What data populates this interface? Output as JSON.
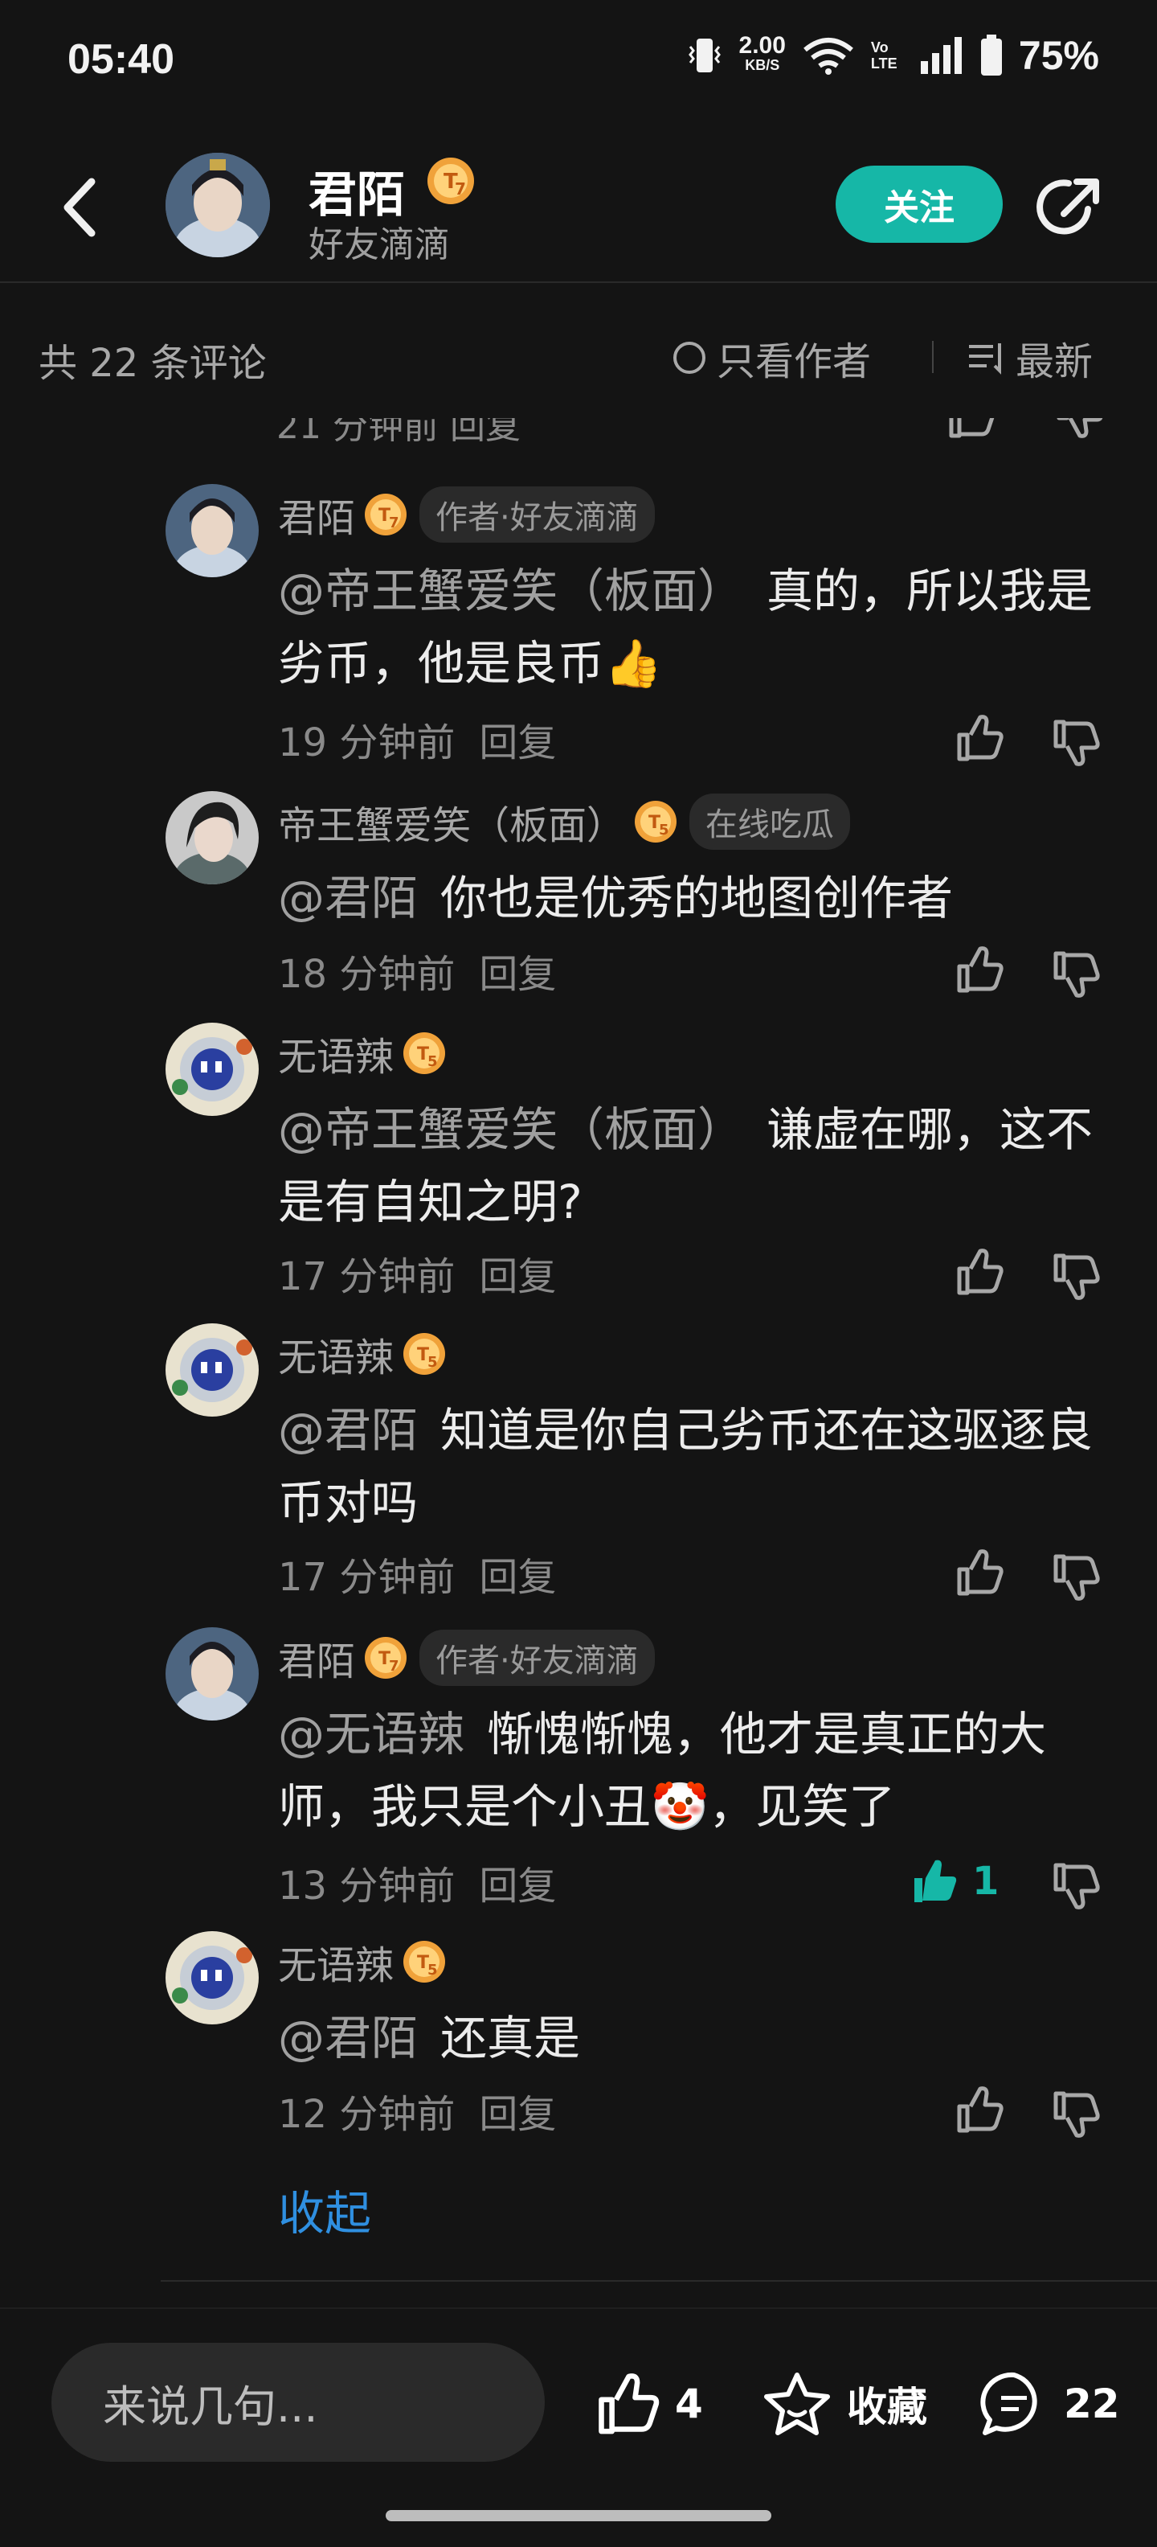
{
  "status_bar": {
    "time": "05:40",
    "net_speed_value": "2.00",
    "net_speed_unit": "KB/S",
    "volte": "Vo LTE",
    "battery": "75%"
  },
  "header": {
    "name": "君陌",
    "level_badge": "7",
    "subtitle": "好友滴滴",
    "follow_label": "关注"
  },
  "comment_bar": {
    "total": "共 22 条评论",
    "only_author": "只看作者",
    "sort": "最新"
  },
  "partial_row": {
    "text": "21 分钟前 回复"
  },
  "comments": [
    {
      "name": "君陌",
      "badge": "7",
      "tag": "作者·好友滴滴",
      "mention": "@帝王蟹爱笑（板面）",
      "text": "真的，所以我是劣币，他是良币👍",
      "time": "19 分钟前",
      "reply": "回复"
    },
    {
      "name": "帝王蟹爱笑（板面）",
      "badge": "5",
      "tag": "在线吃瓜",
      "mention": "@君陌",
      "text": "你也是优秀的地图创作者",
      "time": "18 分钟前",
      "reply": "回复"
    },
    {
      "name": "无语辣",
      "badge": "5",
      "tag": "",
      "mention": "@帝王蟹爱笑（板面）",
      "text": "谦虚在哪，这不是有自知之明?",
      "time": "17 分钟前",
      "reply": "回复"
    },
    {
      "name": "无语辣",
      "badge": "5",
      "tag": "",
      "mention": "@君陌",
      "text": "知道是你自己劣币还在这驱逐良币对吗",
      "time": "17 分钟前",
      "reply": "回复"
    },
    {
      "name": "君陌",
      "badge": "7",
      "tag": "作者·好友滴滴",
      "mention": "@无语辣",
      "text": "惭愧惭愧，他才是真正的大师，我只是个小丑🤡，见笑了",
      "time": "13 分钟前",
      "reply": "回复",
      "likes": "1"
    },
    {
      "name": "无语辣",
      "badge": "5",
      "tag": "",
      "mention": "@君陌",
      "text": "还真是",
      "time": "12 分钟前",
      "reply": "回复"
    }
  ],
  "collapse_label": "收起",
  "bottom_bar": {
    "input_placeholder": "来说几句...",
    "like_count": "4",
    "favorite_label": "收藏",
    "comment_count": "22"
  },
  "colors": {
    "accent": "#16b7a7",
    "link": "#2f8fe0",
    "badge": "#f0a23a",
    "background": "#141414"
  },
  "icons": [
    "back-icon",
    "share-icon",
    "radio-icon",
    "sort-icon",
    "thumb-up-icon",
    "thumb-down-icon",
    "star-icon",
    "comment-icon",
    "level-badge-icon"
  ]
}
